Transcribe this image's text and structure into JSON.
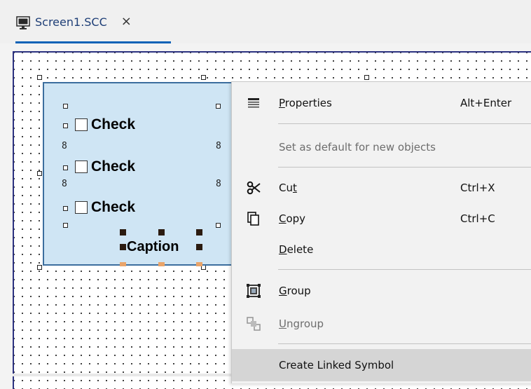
{
  "tab": {
    "label": "Screen1.SCC",
    "close": "×",
    "icon": "monitor-icon"
  },
  "canvas": {
    "checkboxes": [
      {
        "label": "Check"
      },
      {
        "label": "Check"
      },
      {
        "label": "Check"
      }
    ],
    "caption": "Caption"
  },
  "menu": {
    "items": [
      {
        "key": "properties",
        "icon": "properties-icon",
        "label": "Properties",
        "mnemonic": "P",
        "shortcut": "Alt+Enter",
        "enabled": true
      },
      {
        "key": "set-default",
        "icon": null,
        "label": "Set as default for new objects",
        "shortcut": "",
        "enabled": false
      },
      {
        "key": "cut",
        "icon": "scissors-icon",
        "label": "Cut",
        "mnemonic": "t",
        "shortcut": "Ctrl+X",
        "enabled": true
      },
      {
        "key": "copy",
        "icon": "copy-icon",
        "label": "Copy",
        "mnemonic": "C",
        "shortcut": "Ctrl+C",
        "enabled": true
      },
      {
        "key": "delete",
        "icon": null,
        "label": "Delete",
        "mnemonic": "D",
        "shortcut": "",
        "enabled": true
      },
      {
        "key": "group",
        "icon": "group-icon",
        "label": "Group",
        "mnemonic": "G",
        "shortcut": "",
        "enabled": true
      },
      {
        "key": "ungroup",
        "icon": "ungroup-icon",
        "label": "Ungroup",
        "mnemonic": "U",
        "shortcut": "",
        "enabled": false
      },
      {
        "key": "create-linked-symbol",
        "icon": null,
        "label": "Create Linked Symbol",
        "shortcut": "",
        "enabled": true,
        "highlighted": true
      }
    ]
  }
}
